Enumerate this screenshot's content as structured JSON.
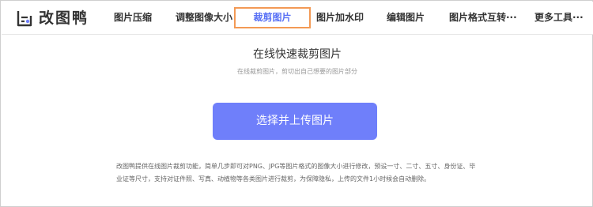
{
  "brand": {
    "name": "改图鸭",
    "color": "#333333"
  },
  "nav": {
    "items": [
      {
        "label": "图片压缩"
      },
      {
        "label": "调整图像大小"
      },
      {
        "label": "裁剪图片",
        "active": true
      },
      {
        "label": "图片加水印"
      },
      {
        "label": "编辑图片"
      },
      {
        "label": "图片格式互转···"
      },
      {
        "label": "更多工具···"
      }
    ],
    "active_color": "#5a72f5",
    "highlight_border_color": "#f39a55"
  },
  "main": {
    "title": "在线快速裁剪图片",
    "subtitle": "在线裁剪图片，剪切出自己想要的图片部分",
    "upload_button": "选择并上传图片",
    "upload_button_color": "#6f7ffa",
    "description": "改图鸭提供在线图片裁剪功能，简单几步即可对PNG、JPG等图片格式的图像大小进行修改，预设一寸、二寸、五寸、身份证、毕业证等尺寸，支持对证件照、写真、动植物等各类图片进行裁剪，为保障隐私，上传的文件1小时候会自动删除。"
  }
}
